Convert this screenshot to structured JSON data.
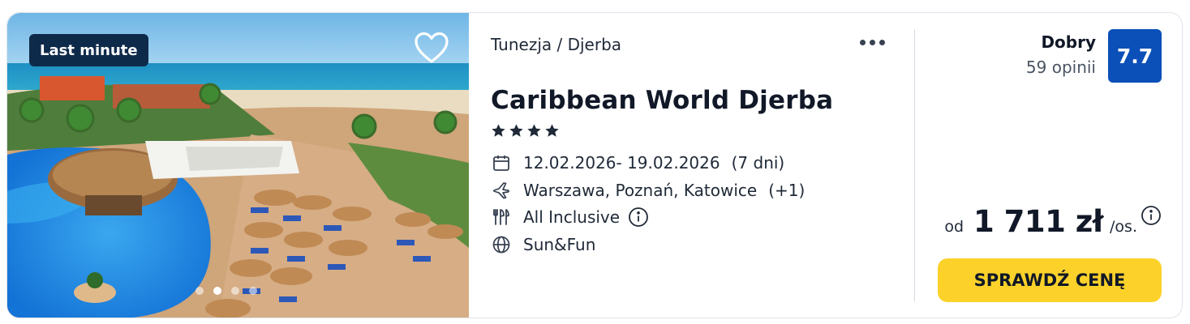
{
  "photo": {
    "badge": "Last minute",
    "favorite_icon": "heart-outline-icon",
    "pager": {
      "count": 4,
      "active": 1
    }
  },
  "hotel": {
    "location": "Tunezja / Djerba",
    "name": "Caribbean World Djerba",
    "stars": 4,
    "more_icon": "more-horizontal-icon"
  },
  "details": {
    "dates": {
      "icon": "calendar-icon",
      "text": "12.02.2026- 19.02.2026",
      "extra": "(7 dni)"
    },
    "departure": {
      "icon": "plane-icon",
      "text": "Warszawa, Poznań, Katowice",
      "extra": "(+1)"
    },
    "board": {
      "icon": "cutlery-icon",
      "text": "All Inclusive",
      "info_icon": "info-icon"
    },
    "theme": {
      "icon": "globe-icon",
      "text": "Sun&Fun"
    }
  },
  "rating": {
    "label": "Dobry",
    "reviews": "59 opinii",
    "score": "7.7"
  },
  "price": {
    "from": "od",
    "value": "1 711 zł",
    "per": "/os.",
    "info_icon": "info-icon"
  },
  "cta": {
    "label": "SPRAWDŹ CENĘ"
  },
  "colors": {
    "badge_bg": "#0e2a4a",
    "score_bg": "#0b4fb8",
    "cta_bg": "#fcd22a"
  }
}
